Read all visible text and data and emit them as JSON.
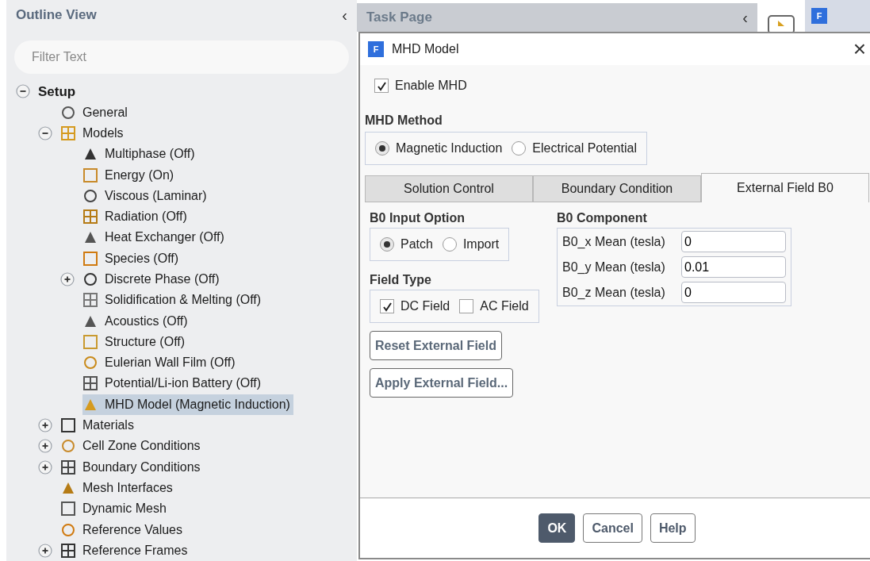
{
  "outline": {
    "title": "Outline View",
    "collapse_glyph": "‹",
    "filter": {
      "placeholder": "Filter Text"
    },
    "tree": [
      {
        "label": "Setup",
        "expanded": true,
        "selected": false,
        "children": [
          {
            "label": "General",
            "selected": false
          },
          {
            "label": "Models",
            "expanded": true,
            "selected": false,
            "children": [
              {
                "label": "Multiphase (Off)",
                "selected": false
              },
              {
                "label": "Energy (On)",
                "selected": false
              },
              {
                "label": "Viscous (Laminar)",
                "selected": false
              },
              {
                "label": "Radiation (Off)",
                "selected": false
              },
              {
                "label": "Heat Exchanger (Off)",
                "selected": false
              },
              {
                "label": "Species (Off)",
                "selected": false
              },
              {
                "label": "Discrete Phase (Off)",
                "expanded": false,
                "selected": false
              },
              {
                "label": "Solidification & Melting (Off)",
                "selected": false
              },
              {
                "label": "Acoustics (Off)",
                "selected": false
              },
              {
                "label": "Structure (Off)",
                "selected": false
              },
              {
                "label": "Eulerian Wall Film (Off)",
                "selected": false
              },
              {
                "label": "Potential/Li-ion Battery (Off)",
                "selected": false
              },
              {
                "label": "MHD Model (Magnetic Induction)",
                "selected": true
              }
            ]
          },
          {
            "label": "Materials",
            "expanded": false,
            "selected": false
          },
          {
            "label": "Cell Zone Conditions",
            "expanded": false,
            "selected": false
          },
          {
            "label": "Boundary Conditions",
            "expanded": false,
            "selected": false
          },
          {
            "label": "Mesh Interfaces",
            "selected": false
          },
          {
            "label": "Dynamic Mesh",
            "selected": false
          },
          {
            "label": "Reference Values",
            "selected": false
          },
          {
            "label": "Reference Frames",
            "expanded": false,
            "selected": false
          }
        ]
      }
    ]
  },
  "task_page": {
    "title": "Task Page",
    "collapse_glyph": "‹"
  },
  "dialog": {
    "title": "MHD Model",
    "app_badge": "F",
    "close_glyph": "×",
    "enable": {
      "label": "Enable MHD",
      "checked": true
    },
    "method": {
      "title": "MHD Method",
      "options": [
        {
          "label": "Magnetic Induction",
          "selected": true
        },
        {
          "label": "Electrical Potential",
          "selected": false
        }
      ]
    },
    "tabs": [
      {
        "label": "Solution Control",
        "selected": false
      },
      {
        "label": "Boundary Condition",
        "selected": false
      },
      {
        "label": "External Field B0",
        "selected": true
      }
    ],
    "input_option": {
      "title": "B0 Input Option",
      "options": [
        {
          "label": "Patch",
          "selected": true
        },
        {
          "label": "Import",
          "selected": false
        }
      ]
    },
    "field_type": {
      "title": "Field Type",
      "options": [
        {
          "label": "DC Field",
          "checked": true
        },
        {
          "label": "AC Field",
          "checked": false
        }
      ]
    },
    "actions": [
      "Reset External Field",
      "Apply External Field..."
    ],
    "component": {
      "title": "B0 Component",
      "fields": [
        {
          "label": "B0_x Mean (tesla)",
          "value": "0"
        },
        {
          "label": "B0_y Mean (tesla)",
          "value": "0.01"
        },
        {
          "label": "B0_z Mean (tesla)",
          "value": "0"
        }
      ]
    },
    "buttons": [
      {
        "label": "OK",
        "selected": true
      },
      {
        "label": "Cancel",
        "selected": false
      },
      {
        "label": "Help",
        "selected": false
      }
    ]
  },
  "side_strip": {
    "badge": "F"
  }
}
